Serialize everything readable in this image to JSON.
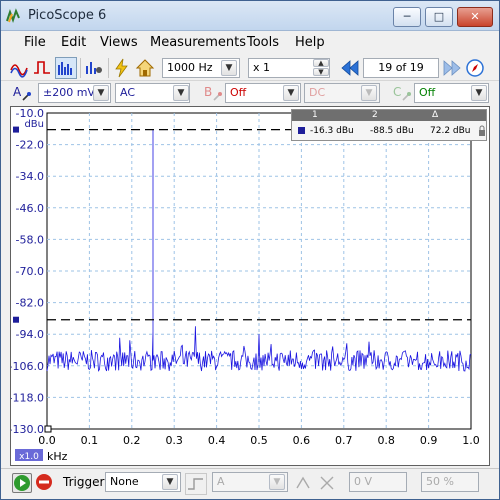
{
  "window": {
    "title": "PicoScope 6",
    "minimize_label": "─",
    "maximize_label": "□",
    "close_label": "✕"
  },
  "menu": {
    "items": [
      "File",
      "Edit",
      "Views",
      "Measurements",
      "Tools",
      "Help"
    ]
  },
  "toolbar": {
    "timebase": "1000 Hz",
    "zoom": "x 1",
    "page": "19 of 19"
  },
  "channels": {
    "a_label": "A",
    "a_range": "±200 mV",
    "a_coupling": "AC",
    "b_label": "B",
    "b_range": "Off",
    "b_coupling": "DC",
    "c_label": "C",
    "c_range": "Off",
    "accent_red": "#cc0000",
    "accent_green": "#008000"
  },
  "rulers": {
    "header": [
      "1",
      "2",
      "Δ"
    ],
    "values": [
      "-16.3 dBu",
      "-88.5 dBu",
      "72.2 dBu"
    ]
  },
  "chart_data": {
    "type": "line",
    "y_unit": "dBu",
    "x_unit": "kHz",
    "y_ticks": [
      "-10.0",
      "-22.0",
      "-34.0",
      "-46.0",
      "-58.0",
      "-70.0",
      "-82.0",
      "-94.0",
      "-106.0",
      "-118.0",
      "-130.0"
    ],
    "x_ticks": [
      "0.0",
      "0.1",
      "0.2",
      "0.3",
      "0.4",
      "0.5",
      "0.6",
      "0.7",
      "0.8",
      "0.9",
      "1.0"
    ],
    "ylim": [
      -130,
      -10
    ],
    "xlim": [
      0,
      1
    ],
    "grid": true,
    "series": [
      {
        "peak_x": 0.25,
        "peak_y": -16.3,
        "noise_floor": -104,
        "noise_amplitude": 4,
        "spurs": [
          {
            "x": 0.35,
            "y": -91
          },
          {
            "x": 0.5,
            "y": -94
          },
          {
            "x": 0.25,
            "y": -93
          }
        ]
      }
    ],
    "ruler1_y": -16.3,
    "ruler2_y": -88.5,
    "trace_color": "#1a14e0"
  },
  "status": {
    "zoom_badge": "x1.0",
    "trigger_label": "Trigger",
    "trigger_mode": "None",
    "trigger_channel": "A",
    "trigger_level": "0 V",
    "trigger_pct": "50 %"
  }
}
